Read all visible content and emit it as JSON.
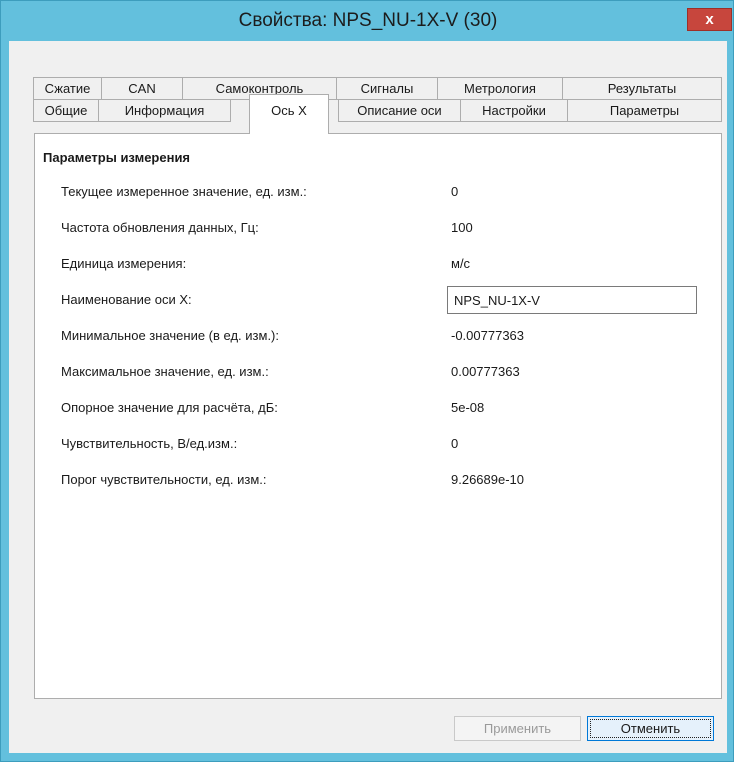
{
  "window": {
    "title": "Свойства: NPS_NU-1X-V (30)",
    "close_glyph": "x"
  },
  "tabs_row1": [
    {
      "label": "Сжатие"
    },
    {
      "label": "CAN"
    },
    {
      "label": "Самоконтроль"
    },
    {
      "label": "Сигналы"
    },
    {
      "label": "Метрология"
    },
    {
      "label": "Результаты"
    }
  ],
  "tabs_row2": [
    {
      "label": "Общие"
    },
    {
      "label": "Информация"
    },
    {
      "label": "Ось X",
      "active": true
    },
    {
      "label": "Описание оси"
    },
    {
      "label": "Настройки"
    },
    {
      "label": "Параметры"
    }
  ],
  "section": {
    "title": "Параметры измерения",
    "fields": [
      {
        "label": "Текущее измеренное значение, ед. изм.:",
        "value": "0"
      },
      {
        "label": "Частота обновления данных, Гц:",
        "value": "100"
      },
      {
        "label": "Единица измерения:",
        "value": "м/с"
      },
      {
        "label": "Наименование оси X:",
        "value": "NPS_NU-1X-V",
        "editable": true
      },
      {
        "label": "Минимальное значение (в ед. изм.):",
        "value": "-0.00777363"
      },
      {
        "label": "Максимальное значение, ед. изм.:",
        "value": "0.00777363"
      },
      {
        "label": "Опорное значение для расчёта, дБ:",
        "value": "5e-08"
      },
      {
        "label": "Чувствительность, В/ед.изм.:",
        "value": "0"
      },
      {
        "label": "Порог чувствительности, ед. изм.:",
        "value": "9.26689e-10"
      }
    ]
  },
  "buttons": {
    "apply": "Применить",
    "cancel": "Отменить"
  },
  "colors": {
    "title_bar": "#63c0dd",
    "close_button": "#c7463d",
    "focus_border": "#0078d7"
  }
}
